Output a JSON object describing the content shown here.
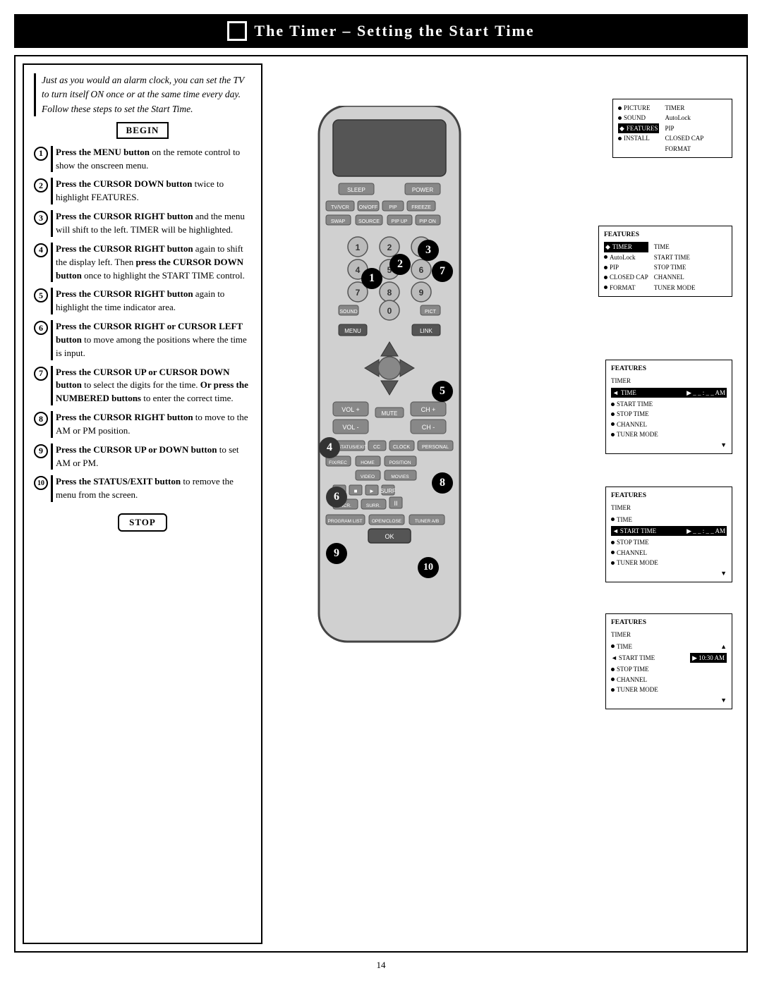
{
  "title": "The Timer – Setting the Start Time",
  "intro": {
    "text": "Just as you would an alarm clock, you can set the TV to turn itself ON once or at the same time every day. Follow these steps to set the Start Time."
  },
  "begin_label": "BEGIN",
  "stop_label": "STOP",
  "steps": [
    {
      "number": "1",
      "text_bold": "Press the MENU button",
      "text": " on the remote control to show the onscreen menu."
    },
    {
      "number": "2",
      "text_bold": "Press the CURSOR DOWN button",
      "text": " twice to highlight FEATURES."
    },
    {
      "number": "3",
      "text_bold": "Press the CURSOR RIGHT button",
      "text": " and the menu will shift to the left. TIMER will be highlighted."
    },
    {
      "number": "4",
      "text_bold": "Press the CURSOR RIGHT button",
      "text": " again to shift the display left. Then ",
      "text2_bold": "press the CURSOR DOWN button",
      "text2": " once to highlight the START TIME control."
    },
    {
      "number": "5",
      "text_bold": "Press the CURSOR RIGHT button",
      "text": " again to highlight the time indicator area."
    },
    {
      "number": "6",
      "text_bold": "Press the CURSOR RIGHT or CURSOR LEFT button",
      "text": " to move among the positions where the time is input."
    },
    {
      "number": "7",
      "text_bold": "Press the CURSOR UP or CURSOR DOWN button",
      "text": " to select the digits for the time. ",
      "text2_bold": "Or press the NUMBERED buttons",
      "text2": " to enter the correct time."
    },
    {
      "number": "8",
      "text_bold": "Press the CURSOR RIGHT button",
      "text": " to move to the AM or PM position."
    },
    {
      "number": "9",
      "text_bold": "Press the CURSOR UP or DOWN button",
      "text": " to set AM or PM."
    },
    {
      "number": "10",
      "text_bold": "Press the STATUS/EXIT button",
      "text": " to remove the menu from the screen."
    }
  ],
  "page_number": "14",
  "screens": {
    "screen1": {
      "left_col": [
        "PICTURE",
        "SOUND",
        "FEATURES",
        "INSTALL"
      ],
      "right_col": [
        "TIMER",
        "AutoLock",
        "PIP",
        "CLOSED CAP",
        "FORMAT"
      ],
      "highlight_left": "FEATURES"
    },
    "screen2": {
      "header": "FEATURES",
      "items": [
        "TIMER",
        "AutoLock",
        "PIP",
        "CLOSED CAP",
        "FORMAT"
      ],
      "right_col": [
        "TIME",
        "START TIME",
        "STOP TIME",
        "CHANNEL",
        "TUNER MODE"
      ],
      "highlight": "TIMER"
    },
    "screen3": {
      "header": "FEATURES",
      "sub": "TIMER",
      "items": [
        "TIME",
        "START TIME",
        "STOP TIME",
        "CHANNEL",
        "TUNER MODE"
      ],
      "highlight": "TIME",
      "value": "_ _ : _ _ AM"
    },
    "screen4": {
      "header": "FEATURES",
      "sub": "TIMER",
      "items": [
        "TIME",
        "START TIME",
        "STOP TIME",
        "CHANNEL",
        "TUNER MODE"
      ],
      "highlight": "START TIME",
      "value": "_ _ : _ _ AM"
    },
    "screen5": {
      "header": "FEATURES",
      "sub": "TIMER",
      "items": [
        "TIME",
        "START TIME",
        "STOP TIME",
        "CHANNEL",
        "TUNER MODE"
      ],
      "highlight": "START TIME",
      "value": "10:30 AM"
    }
  }
}
